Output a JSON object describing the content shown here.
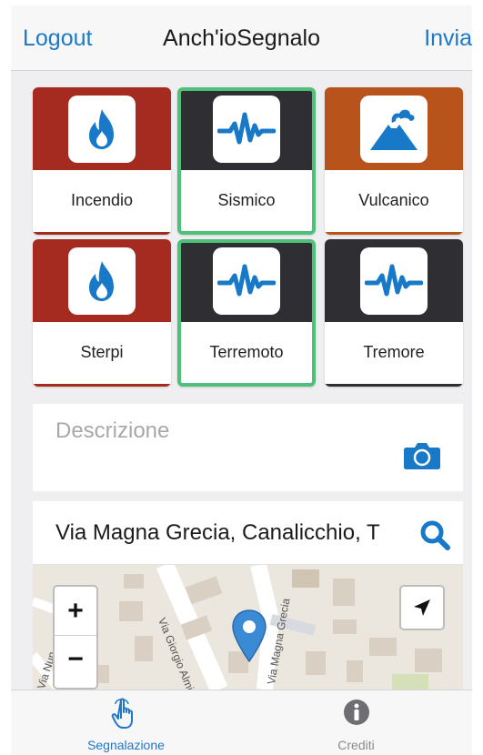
{
  "header": {
    "left_label": "Logout",
    "title": "Anch'ioSegnalo",
    "right_label": "Invia"
  },
  "categories": [
    {
      "label": "Incendio",
      "icon": "fire-icon",
      "band_color": "#a52a1f",
      "selected": false
    },
    {
      "label": "Sismico",
      "icon": "seismic-wave-icon",
      "band_color": "#2f2f33",
      "selected": true
    },
    {
      "label": "Vulcanico",
      "icon": "volcano-icon",
      "band_color": "#b9531c",
      "selected": false
    },
    {
      "label": "Sterpi",
      "icon": "fire-icon",
      "band_color": "#a52a1f",
      "selected": false
    },
    {
      "label": "Terremoto",
      "icon": "seismic-wave-icon",
      "band_color": "#2f2f33",
      "selected": true
    },
    {
      "label": "Tremore",
      "icon": "seismic-wave-icon",
      "band_color": "#2f2f33",
      "selected": false
    }
  ],
  "description": {
    "placeholder": "Descrizione"
  },
  "address": {
    "value": "Via Magna Grecia, Canalicchio, T"
  },
  "map": {
    "street_labels": [
      "Via Giorgio Almirante",
      "Via Magna Grecia",
      "Via Nun"
    ]
  },
  "tabs": [
    {
      "label": "Segnalazione",
      "icon": "hand-pointer-icon",
      "active": true
    },
    {
      "label": "Crediti",
      "icon": "info-icon",
      "active": false
    }
  ],
  "colors": {
    "accent": "#1e78c8",
    "selected_border": "#4ec07a",
    "icon_blue": "#1779c7",
    "pin": "#3a8ad6"
  }
}
